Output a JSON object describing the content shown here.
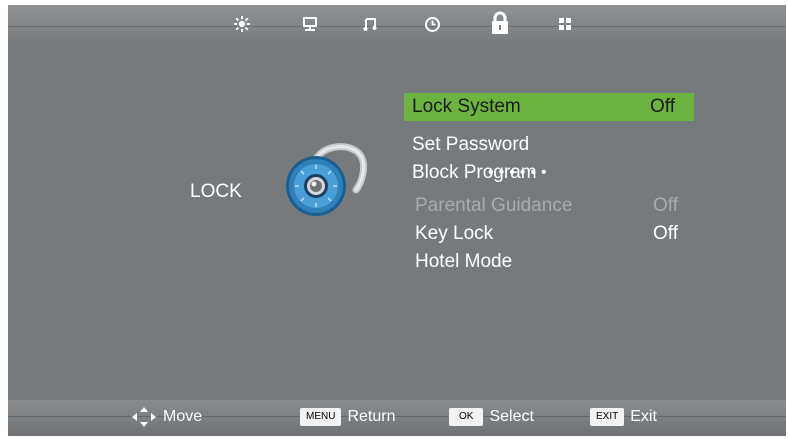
{
  "tabs": [
    {
      "icon": "picture-icon"
    },
    {
      "icon": "screen-icon"
    },
    {
      "icon": "music-icon"
    },
    {
      "icon": "clock-icon"
    },
    {
      "icon": "lock-icon"
    },
    {
      "icon": "apps-icon"
    }
  ],
  "page": {
    "title": "LOCK"
  },
  "menu": {
    "items": [
      {
        "label": "Lock System",
        "value": "Off",
        "state": "selected"
      },
      {
        "label": "Set Password",
        "value": "",
        "state": "normal"
      },
      {
        "label": "Block Program",
        "value": "",
        "state": "normal"
      },
      {
        "label": "Parental Guidance",
        "value": "Off",
        "state": "disabled"
      },
      {
        "label": "Key Lock",
        "value": "Off",
        "state": "normal"
      },
      {
        "label": "Hotel Mode",
        "value": "",
        "state": "normal"
      }
    ],
    "password_mask": "••••••"
  },
  "footer": {
    "move_label": "Move",
    "menu_key": "MENU",
    "return_label": "Return",
    "ok_key": "OK",
    "select_label": "Select",
    "exit_key": "EXIT",
    "exit_label": "Exit"
  },
  "colors": {
    "background": "#777a7d",
    "highlight": "#6db33f",
    "text": "#ffffff",
    "disabled_text": "#a9acaf"
  }
}
